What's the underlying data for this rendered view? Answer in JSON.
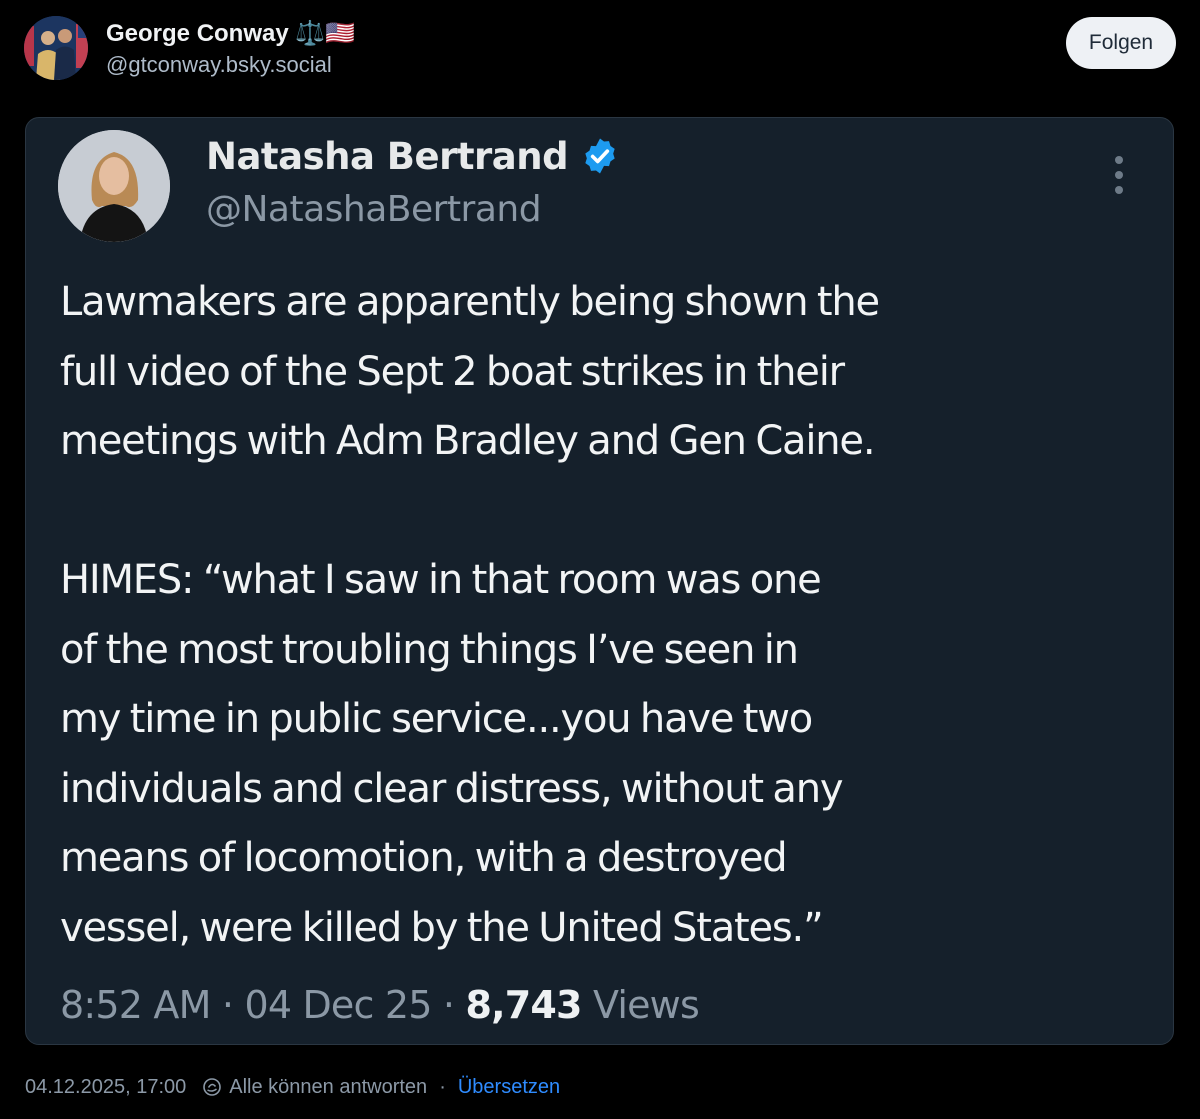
{
  "post": {
    "author": {
      "display_name": "George Conway ⚖️🇺🇸",
      "handle": "@gtconway.bsky.social"
    },
    "follow_label": "Folgen",
    "timestamp": "04.12.2025, 17:00",
    "reply_setting": "Alle können antworten",
    "separator": "·",
    "translate_label": "Übersetzen"
  },
  "embed": {
    "author": {
      "name": "Natasha Bertrand",
      "handle": "@NatashaBertrand",
      "verified": true
    },
    "text": "Lawmakers are apparently being shown the\nfull video of the Sept 2 boat strikes in their\nmeetings with Adm Bradley and Gen Caine.\n\nHIMES: “what I saw in that room was one\nof the most troubling things I’ve seen in\nmy time in public service...you have two\nindividuals and clear distress, without any\nmeans of locomotion, with a destroyed\nvessel, were killed by the United States.”",
    "time": "8:52 AM",
    "date": "04 Dec 25",
    "views_count": "8,743",
    "views_label": "Views",
    "meta_separator": "·"
  },
  "icons": {
    "verified": "verified-badge-icon",
    "more": "more-vertical-icon",
    "reply_setting": "reply-setting-icon"
  },
  "colors": {
    "background": "#000000",
    "card_background": "#15202b",
    "verified": "#1d9bf0",
    "link": "#2f8cff",
    "follow_button": "#eef1f5"
  }
}
